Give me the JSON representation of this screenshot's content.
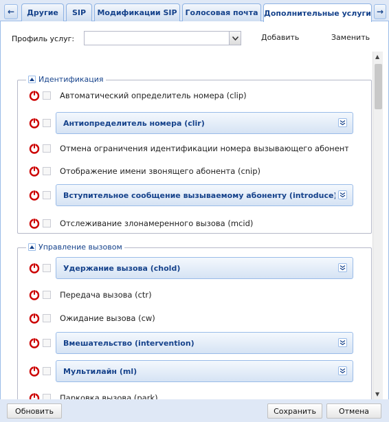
{
  "tabs": {
    "items": [
      {
        "label": "Другие"
      },
      {
        "label": "SIP"
      },
      {
        "label": "Модификации SIP"
      },
      {
        "label": "Голосовая почта"
      },
      {
        "label": "Дополнительные услуги"
      }
    ],
    "active": "Дополнительные услуги"
  },
  "profile": {
    "label": "Профиль услуг:",
    "value": "",
    "add_label": "Добавить",
    "replace_label": "Заменить"
  },
  "sections": [
    {
      "title": "Идентификация",
      "rows": [
        {
          "type": "item",
          "label": "Автоматический определитель номера (clip)"
        },
        {
          "type": "group",
          "label": "Антиопределитель номера (clir)"
        },
        {
          "type": "item",
          "label": "Отмена ограничения идентификации номера вызывающего абонента"
        },
        {
          "type": "item",
          "label": "Отображение имени звонящего абонента (cnip)"
        },
        {
          "type": "group",
          "label": "Вступительное сообщение вызываемому абоненту (introduce)"
        },
        {
          "type": "item",
          "label": "Отслеживание злонамеренного вызова (mcid)"
        }
      ]
    },
    {
      "title": "Управление вызовом",
      "rows": [
        {
          "type": "group",
          "label": "Удержание вызова (chold)"
        },
        {
          "type": "item",
          "label": "Передача вызова (ctr)"
        },
        {
          "type": "item",
          "label": "Ожидание вызова (cw)"
        },
        {
          "type": "group",
          "label": "Вмешательство (intervention)"
        },
        {
          "type": "group",
          "label": "Мультилайн (ml)"
        },
        {
          "type": "item",
          "label": "Парковка вызова (park)"
        }
      ]
    }
  ],
  "buttons": {
    "refresh": "Обновить",
    "save": "Сохранить",
    "cancel": "Отмена"
  },
  "colors": {
    "accent": "#15428b",
    "power_icon": "#cc0000",
    "border": "#99bbe8"
  }
}
